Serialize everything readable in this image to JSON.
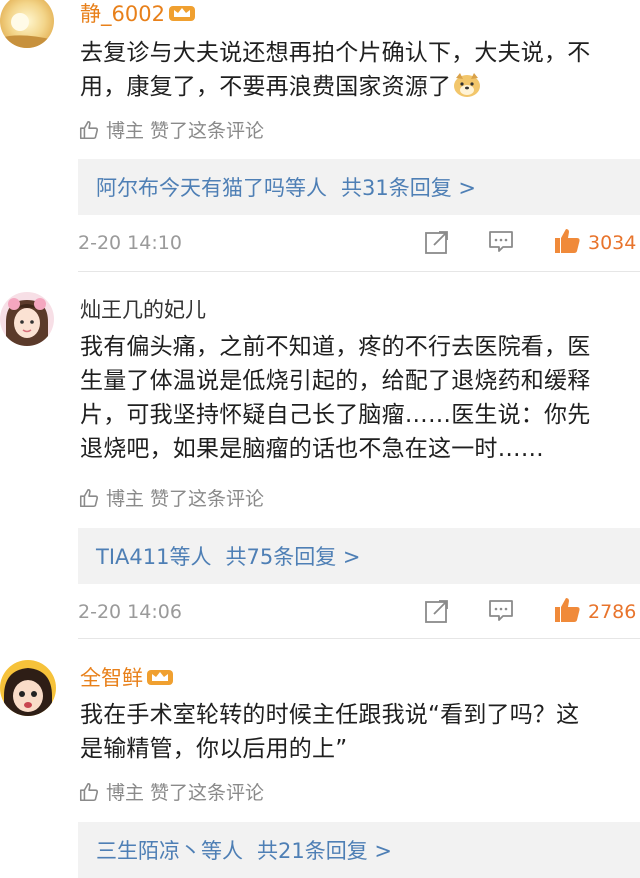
{
  "comments": [
    {
      "username": "静_6002",
      "vip": true,
      "text": "去复诊与大夫说还想再拍个片确认下，大夫说，不\n用，康复了，不要再浪费国家资源了",
      "liked_by": "博主 赞了这条评论",
      "reply_users": "阿尔布今天有猫了吗等人",
      "reply_count": "共31条回复 >",
      "time": "2-20 14:10",
      "likes": "3034",
      "emoji": "doge-emoji"
    },
    {
      "username": "灿王几的妃儿",
      "vip": false,
      "text": "我有偏头痛，之前不知道，疼的不行去医院看，医\n生量了体温说是低烧引起的，给配了退烧药和缓释\n片，可我坚持怀疑自己长了脑瘤……医生说：你先\n退烧吧，如果是脑瘤的话也不急在这一时……",
      "liked_by": "博主 赞了这条评论",
      "reply_users": "TIA411等人",
      "reply_count": "共75条回复 >",
      "time": "2-20 14:06",
      "likes": "2786"
    },
    {
      "username": "全智鲜",
      "vip": true,
      "text": "我在手术室轮转的时候主任跟我说“看到了吗？这\n是输精管，你以后用的上”",
      "liked_by": "博主 赞了这条评论",
      "reply_users": "三生陌凉丶等人",
      "reply_count": "共21条回复 >"
    }
  ],
  "colors": {
    "link": "#4e7fb5",
    "vip_name": "#e8801a",
    "like_count": "#e8742c",
    "muted": "#8a8a8a",
    "reply_bg": "#f2f2f2"
  }
}
